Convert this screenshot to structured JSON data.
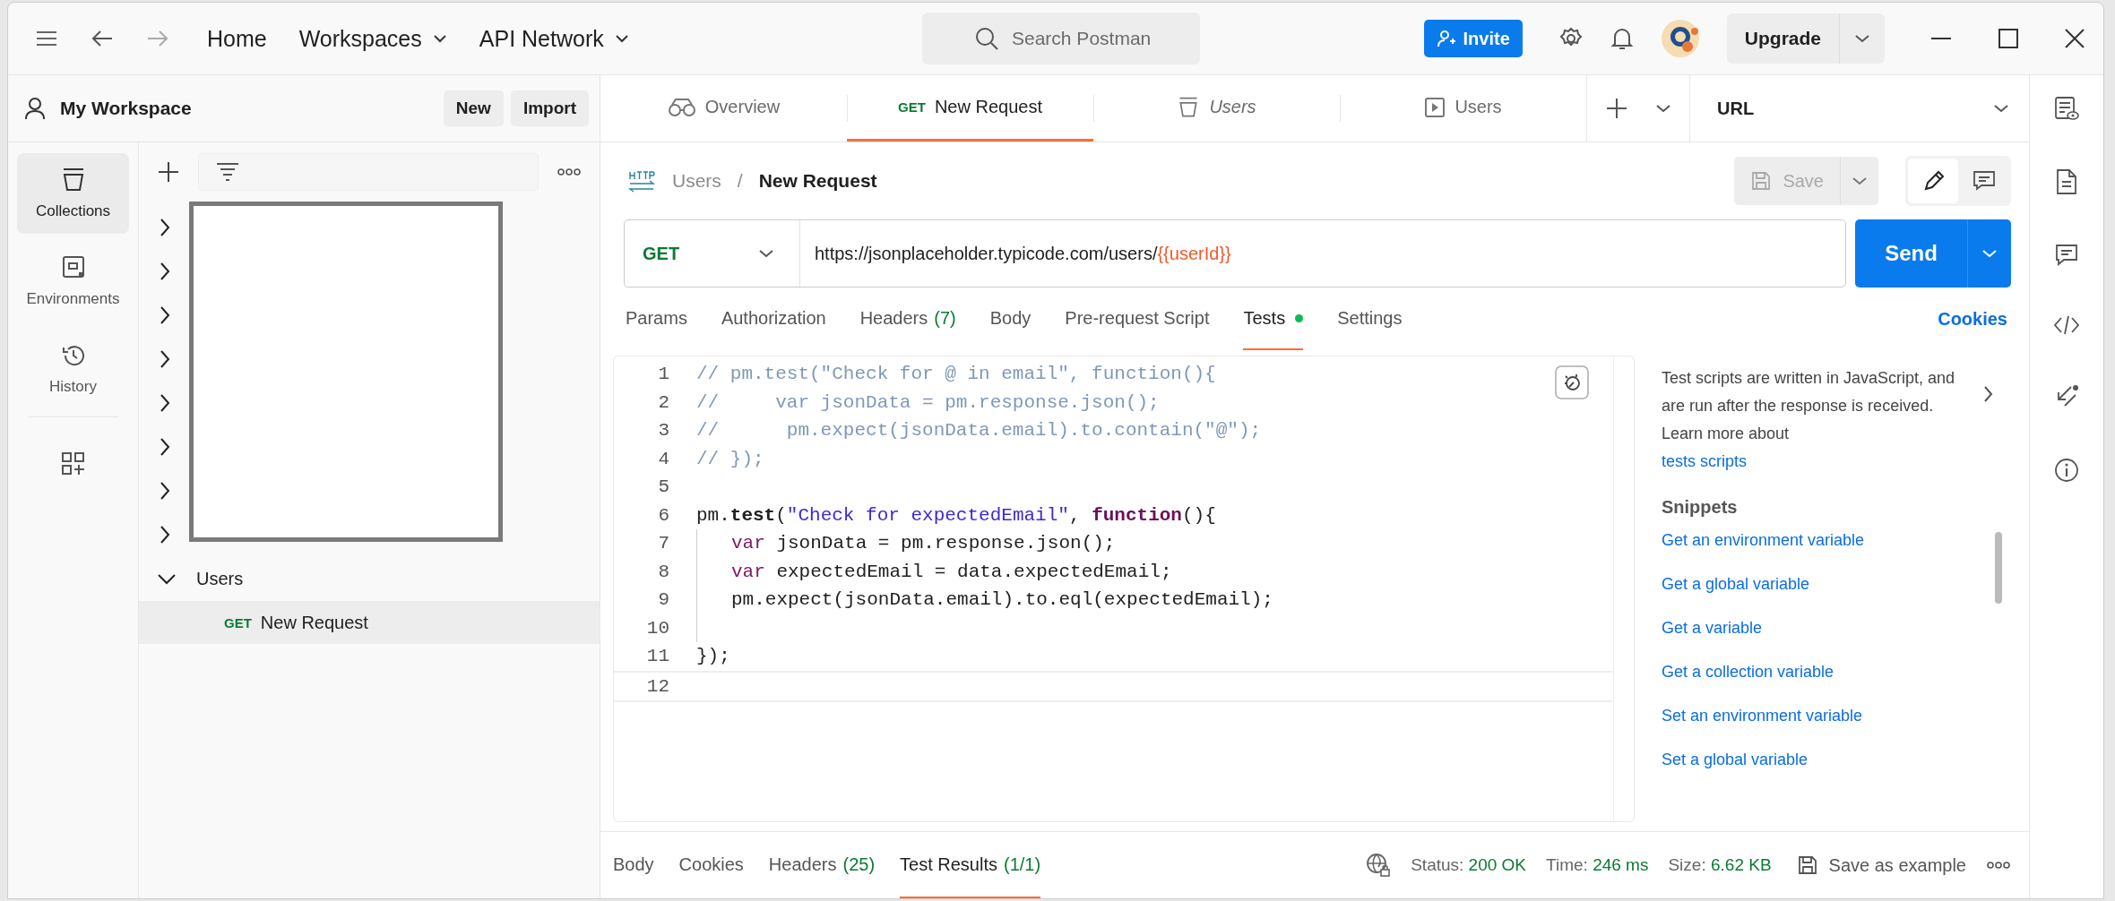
{
  "titlebar": {
    "nav": [
      {
        "label": "Home",
        "dropdown": false
      },
      {
        "label": "Workspaces",
        "dropdown": true
      },
      {
        "label": "API Network",
        "dropdown": true
      }
    ],
    "search_placeholder": "Search Postman",
    "invite": "Invite",
    "upgrade": "Upgrade"
  },
  "workspace": {
    "name": "My Workspace",
    "buttons": [
      "New",
      "Import"
    ]
  },
  "sidebar_nav": [
    {
      "kind": "collections",
      "label": "Collections",
      "selected": true
    },
    {
      "kind": "environments",
      "label": "Environments",
      "selected": false
    },
    {
      "kind": "history",
      "label": "History",
      "selected": false
    }
  ],
  "collections": [
    {
      "expanded": false
    },
    {
      "expanded": false
    },
    {
      "expanded": false
    },
    {
      "expanded": false
    },
    {
      "expanded": false
    },
    {
      "expanded": false
    },
    {
      "expanded": false
    },
    {
      "expanded": false
    },
    {
      "name": "Users",
      "expanded": true,
      "children": [
        {
          "method": "GET",
          "name": "New Request",
          "selected": true
        }
      ]
    }
  ],
  "tabs": [
    {
      "kind": "overview",
      "label": "Overview",
      "selected": false,
      "preview": false
    },
    {
      "kind": "request",
      "method": "GET",
      "label": "New Request",
      "selected": true,
      "preview": false
    },
    {
      "kind": "collection",
      "label": "Users",
      "selected": false,
      "preview": true
    },
    {
      "kind": "runner",
      "label": "Users",
      "selected": false,
      "preview": false
    }
  ],
  "environment": "URL",
  "breadcrumb": {
    "parent": "Users",
    "separator": "/",
    "current": "New Request"
  },
  "save": "Save",
  "request": {
    "method": "GET",
    "url": "https://jsonplaceholder.typicode.com/users/",
    "variable": "{{userId}}",
    "send": "Send"
  },
  "request_tabs": [
    {
      "label": "Params",
      "selected": false,
      "dot": false
    },
    {
      "label": "Authorization",
      "selected": false,
      "dot": false
    },
    {
      "label": "Headers",
      "count": "(7)",
      "selected": false,
      "dot": false
    },
    {
      "label": "Body",
      "selected": false,
      "dot": false
    },
    {
      "label": "Pre-request Script",
      "selected": false,
      "dot": false
    },
    {
      "label": "Tests",
      "selected": true,
      "dot": true
    },
    {
      "label": "Settings",
      "selected": false,
      "dot": false
    }
  ],
  "cookies_link": "Cookies",
  "code_lines": [
    {
      "n": "1",
      "tokens": [
        {
          "kind": "comment",
          "text": "// pm.test(\"Check for @ in email\", function(){"
        }
      ]
    },
    {
      "n": "2",
      "tokens": [
        {
          "kind": "comment",
          "text": "//     var jsonData = pm.response.json();"
        }
      ]
    },
    {
      "n": "3",
      "tokens": [
        {
          "kind": "comment",
          "text": "//      pm.expect(jsonData.email).to.contain(\"@\");"
        }
      ]
    },
    {
      "n": "4",
      "tokens": [
        {
          "kind": "comment",
          "text": "// });"
        }
      ]
    },
    {
      "n": "5"
    },
    {
      "n": "6",
      "tokens": [
        {
          "kind": "plain",
          "text": "pm."
        },
        {
          "kind": "method",
          "text": "test"
        },
        {
          "kind": "plain",
          "text": "("
        },
        {
          "kind": "string",
          "text": "\"Check for expectedEmail\""
        },
        {
          "kind": "plain",
          "text": ", "
        },
        {
          "kind": "function",
          "text": "function"
        },
        {
          "kind": "plain",
          "text": "(){"
        }
      ]
    },
    {
      "n": "7",
      "guide": true,
      "tokens": [
        {
          "kind": "keyword",
          "text": "var"
        },
        {
          "kind": "plain",
          "text": " jsonData = pm.response.json();"
        }
      ]
    },
    {
      "n": "8",
      "guide": true,
      "tokens": [
        {
          "kind": "keyword",
          "text": "var"
        },
        {
          "kind": "plain",
          "text": " expectedEmail = data.expectedEmail;"
        }
      ]
    },
    {
      "n": "9",
      "guide": true,
      "tokens": [
        {
          "kind": "plain",
          "text": "pm.expect(jsonData.email).to.eql(expectedEmail);"
        }
      ]
    },
    {
      "n": "10",
      "guide": true
    },
    {
      "n": "11",
      "tokens": [
        {
          "kind": "plain",
          "text": "});"
        }
      ]
    },
    {
      "n": "12",
      "current": true
    }
  ],
  "help": {
    "text": "Test scripts are written in JavaScript, and are run after the response is received. Learn more about",
    "link": "tests scripts",
    "snippets_title": "Snippets",
    "snippets": [
      "Get an environment variable",
      "Get a global variable",
      "Get a variable",
      "Get a collection variable",
      "Set an environment variable",
      "Set a global variable"
    ]
  },
  "response": {
    "tabs": [
      {
        "label": "Body",
        "selected": false
      },
      {
        "label": "Cookies",
        "selected": false
      },
      {
        "label": "Headers",
        "count": "(25)",
        "selected": false
      },
      {
        "label": "Test Results",
        "count": "(1/1)",
        "selected": true
      }
    ],
    "status_label": "Status:",
    "status": "200 OK",
    "time_label": "Time:",
    "time": "246 ms",
    "size_label": "Size:",
    "size": "6.62 KB",
    "save_example": "Save as example"
  }
}
